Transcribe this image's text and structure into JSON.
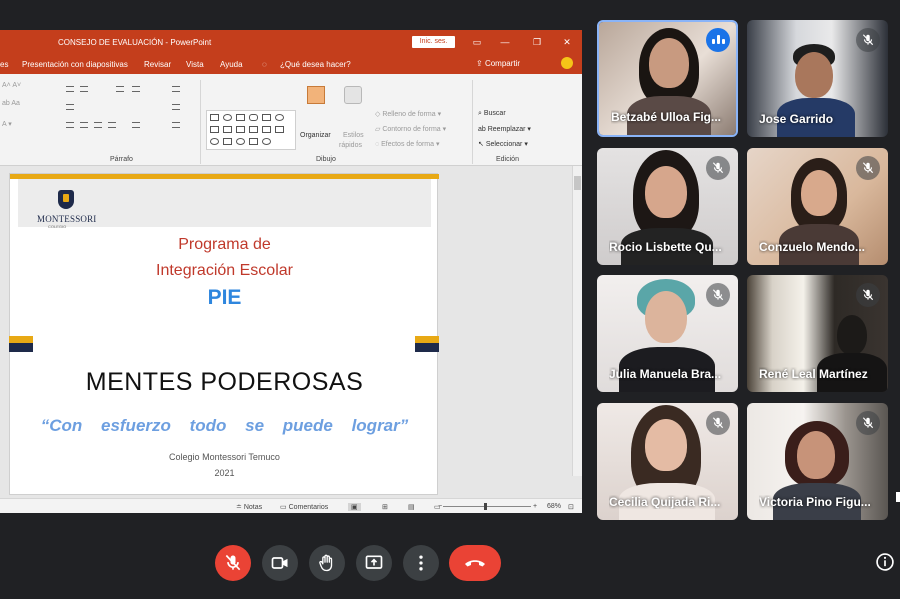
{
  "powerpoint": {
    "title": "CONSEJO DE EVALUACIÓN  -  PowerPoint",
    "sign_in": "Inic. ses.",
    "menu": [
      "es",
      "Presentación con diapositivas",
      "Revisar",
      "Vista",
      "Ayuda"
    ],
    "tell_me": "¿Qué desea hacer?",
    "share": "Compartir",
    "ribbon": {
      "paragraph_group": "Párrafo",
      "drawing_group": "Dibujo",
      "editing_group": "Edición",
      "arrange": "Organizar",
      "quick_styles_1": "Estilos",
      "quick_styles_2": "rápidos",
      "shape_fill": "Relleno de forma",
      "shape_outline": "Contorno de forma",
      "shape_effects": "Efectos de forma",
      "find": "Buscar",
      "replace": "Reemplazar",
      "select": "Seleccionar"
    },
    "status": {
      "notes": "Notas",
      "comments": "Comentarios",
      "zoom": "68%"
    }
  },
  "slide": {
    "logo_name": "MONTESSORI",
    "logo_sub": "COLEGIO",
    "program_line1": "Programa de",
    "program_line2": "Integración Escolar",
    "program_acronym": "PIE",
    "headline": "MENTES PODEROSAS",
    "quote": "“Con esfuerzo todo se puede lograr”",
    "school": "Colegio Montessori Temuco",
    "year": "2021"
  },
  "participants": [
    {
      "name": "Betzabé Ulloa Fig...",
      "speaking": true
    },
    {
      "name": "Jose Garrido",
      "muted": true
    },
    {
      "name": "Rocio Lisbette Qu...",
      "muted": true
    },
    {
      "name": "Conzuelo Mendo...",
      "muted": true
    },
    {
      "name": "Julia Manuela Bra...",
      "muted": true
    },
    {
      "name": "René Leal Martínez",
      "muted": true
    },
    {
      "name": "Cecilia Quijada Ri...",
      "muted": true
    },
    {
      "name": "Victoria Pino Figu...",
      "muted": true
    }
  ],
  "controls": {
    "mic": "mic-off",
    "camera": "camera",
    "raise_hand": "hand",
    "present": "present",
    "more": "more-options",
    "hangup": "hang-up"
  },
  "colors": {
    "ppt_accent": "#c43e1c",
    "meet_bg": "#202124",
    "danger": "#ea4335",
    "active_speaker": "#1a73e8"
  }
}
